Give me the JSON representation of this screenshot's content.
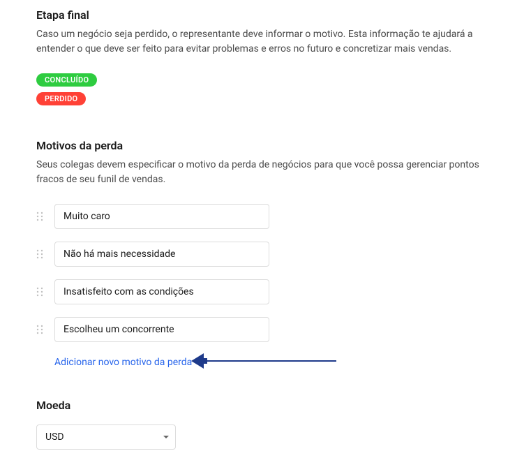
{
  "finalStage": {
    "title": "Etapa final",
    "description": "Caso um negócio seja perdido, o representante deve informar o motivo. Esta informação te ajudará a entender o que deve ser feito para evitar problemas e erros no futuro e concretizar mais vendas.",
    "badges": {
      "completed": "CONCLUÍDO",
      "lost": "PERDIDO"
    }
  },
  "lossReasons": {
    "title": "Motivos da perda",
    "description": "Seus colegas devem especificar o motivo da perda de negócios para que você possa gerenciar pontos fracos de seu funil de vendas.",
    "items": [
      "Muito caro",
      "Não há mais necessidade",
      "Insatisfeito com as condições",
      "Escolheu um concorrente"
    ],
    "addLabel": "Adicionar novo motivo da perda"
  },
  "currency": {
    "title": "Moeda",
    "selected": "USD"
  }
}
